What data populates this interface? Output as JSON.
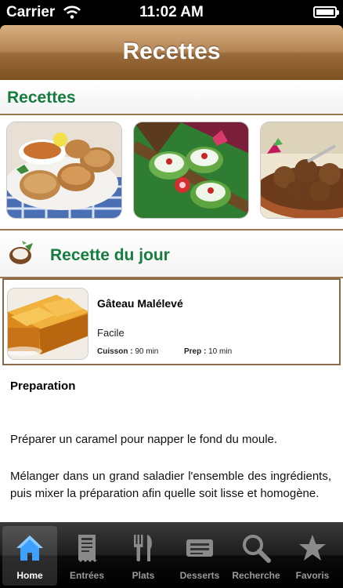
{
  "status_bar": {
    "carrier": "Carrier",
    "time": "11:02 AM"
  },
  "nav_bar": {
    "title": "Recettes"
  },
  "recettes_section": {
    "title": "Recettes"
  },
  "recette_du_jour": {
    "title": "Recette du jour",
    "recipe": {
      "name": "Gâteau Malélevé",
      "difficulty": "Facile",
      "cuisson_label": "Cuisson :",
      "cuisson_value": "90 min",
      "prep_label": "Prep :",
      "prep_value": "10 min"
    }
  },
  "preparation": {
    "title": "Preparation",
    "paragraphs": [
      "Préparer un caramel pour napper le fond du moule.",
      "Mélanger dans un grand saladier l'ensemble des ingrédients, puis mixer la préparation afin quelle soit lisse et homogène."
    ]
  },
  "tab_bar": {
    "tabs": [
      {
        "label": "Home",
        "icon": "home-icon",
        "selected": true
      },
      {
        "label": "Entrées",
        "icon": "menu-card-icon"
      },
      {
        "label": "Plats",
        "icon": "fork-knife-icon"
      },
      {
        "label": "Desserts",
        "icon": "tray-icon"
      },
      {
        "label": "Recherche",
        "icon": "search-icon"
      },
      {
        "label": "Favoris",
        "icon": "star-icon"
      }
    ]
  },
  "colors": {
    "section_title": "#167d3e",
    "nav_bar": "#9b6c3b",
    "separator": "#9b7650"
  }
}
